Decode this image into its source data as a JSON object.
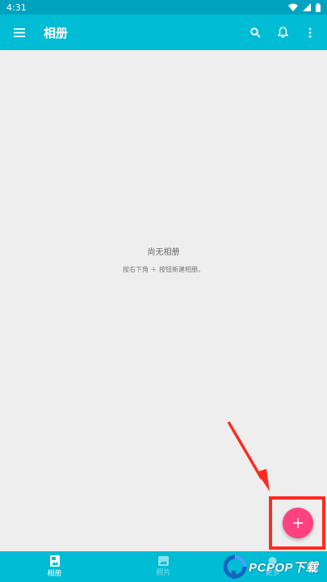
{
  "status_bar": {
    "time": "4:31"
  },
  "app_bar": {
    "title": "相册"
  },
  "empty_state": {
    "title": "尚无相册",
    "hint": "按右下角 ＋ 按钮新建相册。"
  },
  "bottom_nav": {
    "items": [
      {
        "label": "相册",
        "icon": "album-icon",
        "active": true
      },
      {
        "label": "照片",
        "icon": "photo-icon",
        "active": false
      },
      {
        "label": "更多",
        "icon": "more-icon",
        "active": false
      }
    ]
  },
  "fab": {
    "icon": "plus-icon"
  },
  "watermark": {
    "text": "PCPOP下载"
  },
  "colors": {
    "primary": "#00bcd4",
    "status": "#00a3bf",
    "accent": "#ff4081",
    "annotation": "#ff2a1f",
    "background": "#eeeeee"
  }
}
